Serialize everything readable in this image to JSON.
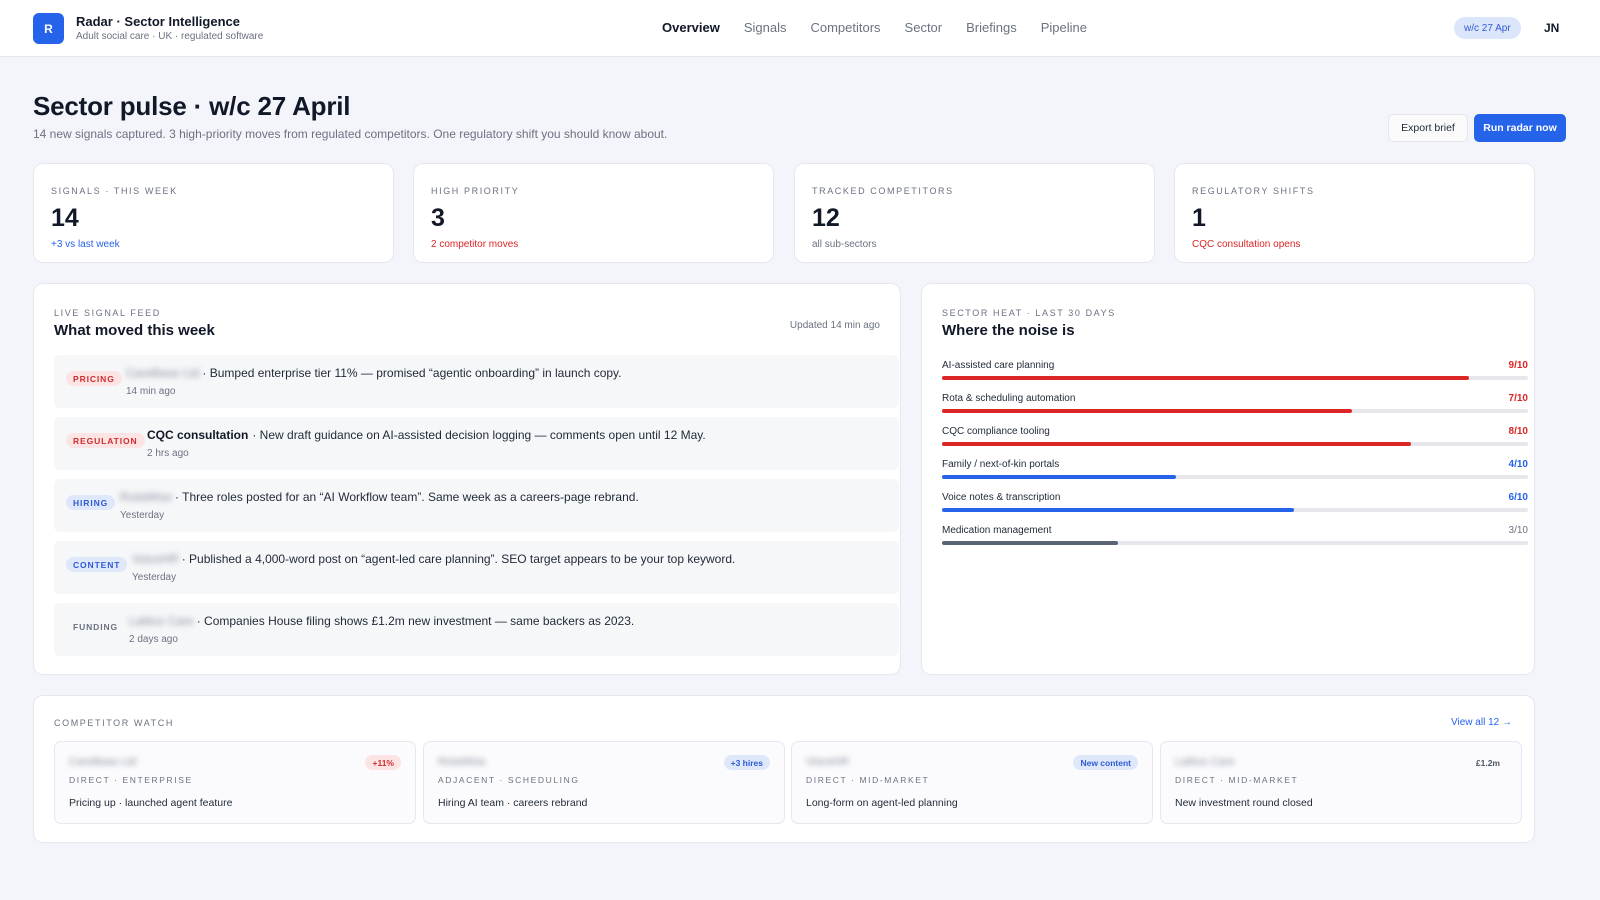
{
  "app": {
    "logo_letter": "R",
    "title": "Radar · Sector Intelligence",
    "subtitle": "Adult social care · UK · regulated software",
    "week_pill": "w/c 27 Apr",
    "user_initials": "JN"
  },
  "nav": {
    "items": [
      "Overview",
      "Signals",
      "Competitors",
      "Sector",
      "Briefings",
      "Pipeline"
    ],
    "active": "Overview"
  },
  "hero": {
    "title": "Sector pulse · w/c 27 April",
    "subtitle": "14 new signals captured. 3 high-priority moves from regulated competitors. One regulatory shift you should know about.",
    "export_label": "Export brief",
    "run_label": "Run radar now",
    "accent": "#2563eb"
  },
  "stats": [
    {
      "label": "Signals · this week",
      "value": "14",
      "note": "+3 vs last week",
      "tone": "blue"
    },
    {
      "label": "High priority",
      "value": "3",
      "note": "2 competitor moves",
      "tone": "red"
    },
    {
      "label": "Tracked competitors",
      "value": "12",
      "note": "all sub-sectors",
      "tone": "grey"
    },
    {
      "label": "Regulatory shifts",
      "value": "1",
      "note": "CQC consultation opens",
      "tone": "red"
    }
  ],
  "feed": {
    "eyebrow": "Live signal feed",
    "title": "What moved this week",
    "updated": "Updated 14 min ago",
    "items": [
      {
        "badge": "PRICING",
        "type": "pricing",
        "source": "CareBase Ltd",
        "source_blurred": true,
        "text": "· Bumped enterprise tier 11% — promised “agentic onboarding” in launch copy.",
        "time": "14 min ago"
      },
      {
        "badge": "REGULATION",
        "type": "regulation",
        "source": "CQC consultation",
        "source_blurred": false,
        "text": "· New draft guidance on AI-assisted decision logging — comments open until 12 May.",
        "time": "2 hrs ago"
      },
      {
        "badge": "HIRING",
        "type": "hiring",
        "source": "RotaWise",
        "source_blurred": true,
        "text": "· Three roles posted for an “AI Workflow team”. Same week as a careers-page rebrand.",
        "time": "Yesterday"
      },
      {
        "badge": "CONTENT",
        "type": "content",
        "source": "VoiceHR",
        "source_blurred": true,
        "text": "· Published a 4,000-word post on “agent-led care planning”. SEO target appears to be your top keyword.",
        "time": "Yesterday"
      },
      {
        "badge": "FUNDING",
        "type": "funding",
        "source": "Lattice Care",
        "source_blurred": true,
        "text": "· Companies House filing shows £1.2m new investment — same backers as 2023.",
        "time": "2 days ago"
      }
    ]
  },
  "heat": {
    "eyebrow": "Sector heat · last 30 days",
    "title": "Where the noise is",
    "rows": [
      {
        "label": "AI-assisted care planning",
        "score": 9,
        "score_label": "9/10",
        "color": "#dc2626"
      },
      {
        "label": "Rota & scheduling automation",
        "score": 7,
        "score_label": "7/10",
        "color": "#dc2626"
      },
      {
        "label": "CQC compliance tooling",
        "score": 8,
        "score_label": "8/10",
        "color": "#dc2626"
      },
      {
        "label": "Family / next-of-kin portals",
        "score": 4,
        "score_label": "4/10",
        "color": "#2563eb"
      },
      {
        "label": "Voice notes & transcription",
        "score": 6,
        "score_label": "6/10",
        "color": "#2563eb"
      },
      {
        "label": "Medication management",
        "score": 3,
        "score_label": "3/10",
        "color": "#5b6477"
      }
    ]
  },
  "watch": {
    "eyebrow": "Competitor watch",
    "view_all": "View all 12 →",
    "cards": [
      {
        "name": "CareBase Ltd",
        "tag": "Direct · Enterprise",
        "desc": "Pricing up · launched agent feature",
        "chip": "+11%",
        "chip_tone": "red"
      },
      {
        "name": "RotaWise",
        "tag": "Adjacent · Scheduling",
        "desc": "Hiring AI team · careers rebrand",
        "chip": "+3 hires",
        "chip_tone": "blue"
      },
      {
        "name": "VoiceHR",
        "tag": "Direct · Mid-market",
        "desc": "Long-form on agent-led planning",
        "chip": "New content",
        "chip_tone": "blue"
      },
      {
        "name": "Lattice Care",
        "tag": "Direct · Mid-market",
        "desc": "New investment round closed",
        "chip": "£1.2m",
        "chip_tone": "plain"
      }
    ]
  }
}
